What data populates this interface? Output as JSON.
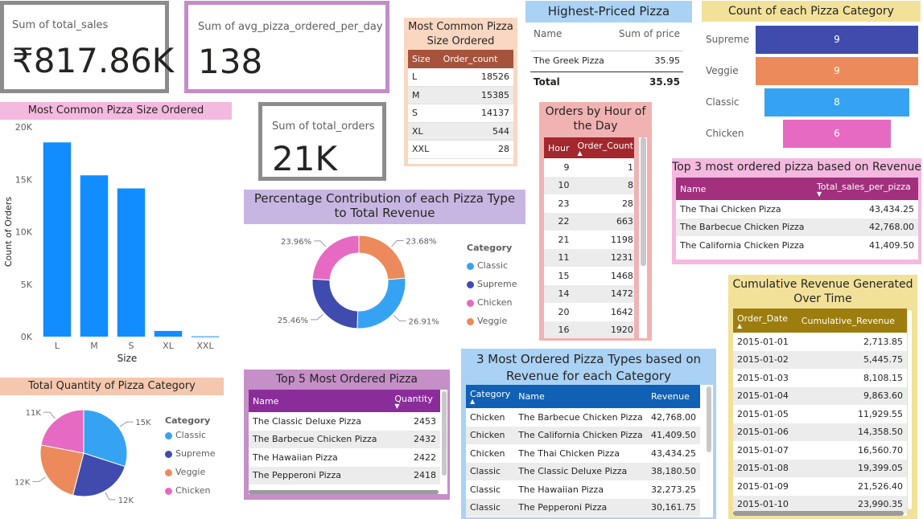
{
  "kpi_total_sales": {
    "label": "Sum of total_sales",
    "value": "₹817.86K"
  },
  "kpi_avg_pizza": {
    "label": "Sum of avg_pizza_ordered_per_day",
    "value": "138"
  },
  "kpi_total_orders": {
    "label": "Sum of total_orders",
    "value": "21K"
  },
  "size_table": {
    "title": "Most Common Pizza Size Ordered",
    "headers": [
      "Size",
      "Order_count"
    ],
    "rows": [
      [
        "L",
        "18526"
      ],
      [
        "M",
        "15385"
      ],
      [
        "S",
        "14137"
      ],
      [
        "XL",
        "544"
      ],
      [
        "XXL",
        "28"
      ]
    ]
  },
  "highest_priced": {
    "title": "Highest-Priced Pizza",
    "headers": [
      "Name",
      "Sum of price"
    ],
    "rows": [
      [
        "The Greek Pizza",
        "35.95"
      ]
    ],
    "total": [
      "Total",
      "35.95"
    ]
  },
  "category_count": {
    "title": "Count of each Pizza Category",
    "chart_data": {
      "type": "bar",
      "orientation": "funnel",
      "categories": [
        "Supreme",
        "Veggie",
        "Classic",
        "Chicken"
      ],
      "values": [
        9,
        9,
        8,
        6
      ],
      "colors": [
        "#3f4cad",
        "#ec8a5b",
        "#36a3f2",
        "#e66ac1"
      ]
    }
  },
  "size_chart": {
    "title": "Most Common Pizza Size Ordered",
    "chart_data": {
      "type": "bar",
      "categories": [
        "L",
        "M",
        "S",
        "XL",
        "XXL"
      ],
      "values": [
        18526,
        15385,
        14137,
        544,
        28
      ],
      "xlabel": "Size",
      "ylabel": "Count of Orders",
      "ylim": [
        0,
        20000
      ],
      "yticks": [
        "20K",
        "15K",
        "10K",
        "5K",
        "0K"
      ],
      "color": "#118dff"
    }
  },
  "hour_table": {
    "title": "Orders by Hour of the Day",
    "headers": [
      "Hour",
      "Order_Count"
    ],
    "rows": [
      [
        "9",
        "1"
      ],
      [
        "10",
        "8"
      ],
      [
        "23",
        "28"
      ],
      [
        "22",
        "663"
      ],
      [
        "21",
        "1198"
      ],
      [
        "11",
        "1231"
      ],
      [
        "15",
        "1468"
      ],
      [
        "14",
        "1472"
      ],
      [
        "20",
        "1642"
      ],
      [
        "16",
        "1920"
      ]
    ]
  },
  "top3_revenue": {
    "title": "Top 3 most ordered pizza based on Revenue",
    "headers": [
      "Name",
      "Total_sales_per_pizza"
    ],
    "rows": [
      [
        "The Thai Chicken Pizza",
        "43,434.25"
      ],
      [
        "The Barbecue Chicken Pizza",
        "42,768.00"
      ],
      [
        "The California Chicken Pizza",
        "41,409.50"
      ]
    ]
  },
  "pct_contribution": {
    "title": "Percentage Contribution of each Pizza Type to Total Revenue",
    "legend_title": "Category",
    "chart_data": {
      "type": "pie",
      "donut": true,
      "categories": [
        "Classic",
        "Supreme",
        "Chicken",
        "Veggie"
      ],
      "values": [
        26.91,
        25.46,
        23.96,
        23.68
      ],
      "labels": [
        "26.91%",
        "25.46%",
        "23.96%",
        "23.68%"
      ],
      "colors": [
        "#36a3f2",
        "#3f4cad",
        "#e66ac1",
        "#ec8a5b"
      ]
    }
  },
  "cumulative": {
    "title": "Cumulative Revenue Generated Over Time",
    "headers": [
      "Order_Date",
      "Cumulative_Revenue"
    ],
    "rows": [
      [
        "2015-01-01",
        "2,713.85"
      ],
      [
        "2015-01-02",
        "5,445.75"
      ],
      [
        "2015-01-03",
        "8,108.15"
      ],
      [
        "2015-01-04",
        "9,863.60"
      ],
      [
        "2015-01-05",
        "11,929.55"
      ],
      [
        "2015-01-06",
        "14,358.50"
      ],
      [
        "2015-01-07",
        "16,560.70"
      ],
      [
        "2015-01-08",
        "19,399.05"
      ],
      [
        "2015-01-09",
        "21,526.40"
      ],
      [
        "2015-01-10",
        "23,990.35"
      ]
    ]
  },
  "quantity_pie": {
    "title": "Total Quantity of Pizza Category",
    "legend_title": "Category",
    "chart_data": {
      "type": "pie",
      "categories": [
        "Classic",
        "Supreme",
        "Veggie",
        "Chicken"
      ],
      "values": [
        15,
        12,
        12,
        11
      ],
      "labels": [
        "15K",
        "12K",
        "12K",
        "11K"
      ],
      "colors": [
        "#36a3f2",
        "#3f4cad",
        "#ec8a5b",
        "#e66ac1"
      ]
    }
  },
  "top5": {
    "title": "Top 5 Most Ordered Pizza",
    "headers": [
      "Name",
      "Quantity"
    ],
    "rows": [
      [
        "The Classic Deluxe Pizza",
        "2453"
      ],
      [
        "The Barbecue Chicken Pizza",
        "2432"
      ],
      [
        "The Hawaiian Pizza",
        "2422"
      ],
      [
        "The Pepperoni Pizza",
        "2418"
      ]
    ]
  },
  "top3_category": {
    "title": "3 Most Ordered Pizza Types based on Revenue for each Category",
    "headers": [
      "Category",
      "Name",
      "Revenue"
    ],
    "rows": [
      [
        "Chicken",
        "The Barbecue Chicken Pizza",
        "42,768.00"
      ],
      [
        "Chicken",
        "The California Chicken Pizza",
        "41,409.50"
      ],
      [
        "Chicken",
        "The Thai Chicken Pizza",
        "43,434.25"
      ],
      [
        "Classic",
        "The Classic Deluxe Pizza",
        "38,180.50"
      ],
      [
        "Classic",
        "The Hawaiian Pizza",
        "32,273.25"
      ],
      [
        "Classic",
        "The Pepperoni Pizza",
        "30,161.75"
      ]
    ]
  }
}
